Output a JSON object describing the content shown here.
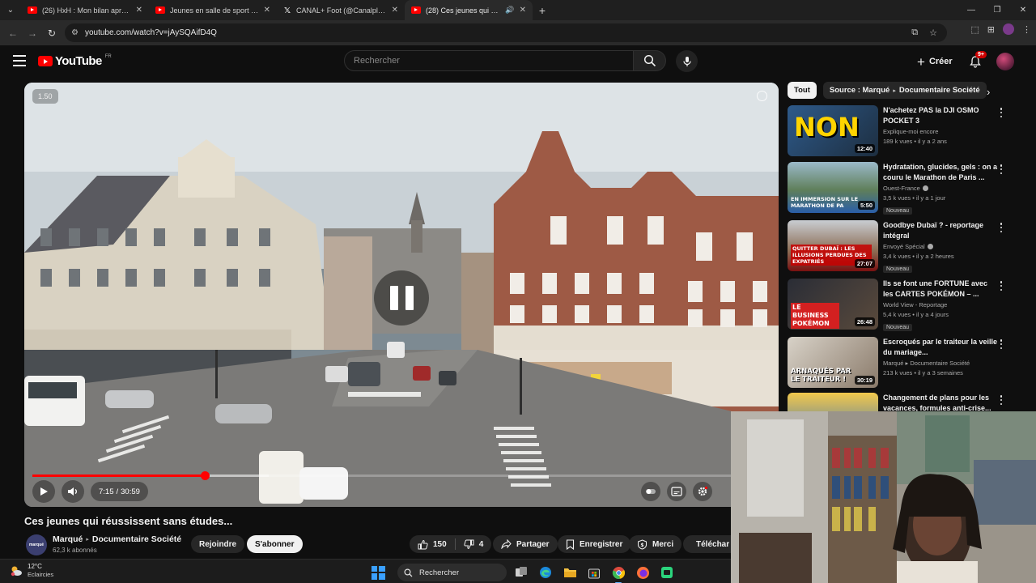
{
  "browser": {
    "tabs": [
      {
        "title": "(26) HxH : Mon bilan après 25 a",
        "icon": "youtube-icon",
        "active": false
      },
      {
        "title": "Jeunes en salle de sport : entre",
        "icon": "youtube-icon",
        "active": false
      },
      {
        "title": "CANAL+ Foot (@CanalplusFoot",
        "icon": "x-icon",
        "active": false
      },
      {
        "title": "(28) Ces jeunes qui réussiss",
        "icon": "youtube-icon",
        "active": true
      }
    ],
    "url": "youtube.com/watch?v=jAySQAifD4Q"
  },
  "youtube": {
    "logo_text": "YouTube",
    "logo_region": "FR",
    "search_placeholder": "Rechercher",
    "create_label": "Créer",
    "notif_badge": "9+"
  },
  "player": {
    "speed_badge": "1.50",
    "current_time": "7:15",
    "duration": "30:59",
    "progress_fraction": 0.234,
    "state": "paused-overlay"
  },
  "video": {
    "title": "Ces jeunes qui réussissent sans études...",
    "channel_name": "Marqué",
    "channel_sub": "Documentaire Société",
    "channel_avatar_text": "marqué",
    "subscribers": "62,3 k abonnés",
    "join_label": "Rejoindre",
    "subscribe_label": "S'abonner",
    "likes": "150",
    "dislikes": "4",
    "share_label": "Partager",
    "save_label": "Enregistrer",
    "thanks_label": "Merci",
    "download_label": "Téléchar"
  },
  "sidebar": {
    "chips": [
      {
        "label": "Tout",
        "active": true
      },
      {
        "label": "Source : Marqué",
        "label2": "Documentaire Société",
        "active": false
      }
    ],
    "recommendations": [
      {
        "title": "N'achetez PAS la DJI OSMO POCKET 3",
        "channel": "Explique-moi encore",
        "verified": false,
        "views": "189 k vues",
        "age": "il y a 2 ans",
        "duration": "12:40",
        "is_new": false,
        "thumb_text": "NON"
      },
      {
        "title": "Hydratation, glucides, gels : on a couru le Marathon de Paris ...",
        "channel": "Ouest-France",
        "verified": true,
        "views": "3,5 k vues",
        "age": "il y a 1 jour",
        "duration": "5:50",
        "is_new": true,
        "new_label": "Nouveau",
        "thumb_text": "EN IMMERSION SUR LE MARATHON DE PA"
      },
      {
        "title": "Goodbye Dubaï ? - reportage intégral",
        "channel": "Envoyé Spécial",
        "verified": true,
        "views": "3,4 k vues",
        "age": "il y a 2 heures",
        "duration": "27:07",
        "is_new": true,
        "new_label": "Nouveau",
        "thumb_text": "QUITTER DUBAÏ : LES ILLUSIONS PERDUES DES EXPATRIÉS"
      },
      {
        "title": "Ils se font une FORTUNE avec les CARTES POKÉMON – ...",
        "channel": "World View - Reportage",
        "verified": false,
        "views": "5,4 k vues",
        "age": "il y a 4 jours",
        "duration": "26:48",
        "is_new": true,
        "new_label": "Nouveau",
        "thumb_text": "LE BUSINESS POKÉMON"
      },
      {
        "title": "Escroqués par le traiteur la veille du mariage...",
        "channel": "Marqué ▸ Documentaire Société",
        "verified": false,
        "views": "213 k vues",
        "age": "il y a 3 semaines",
        "duration": "30:19",
        "is_new": false,
        "thumb_text": "ARNAQUÉS PAR LE TRAITEUR !"
      },
      {
        "title": "Changement de plans pour les vacances, formules anti-crise...",
        "channel": "",
        "verified": false,
        "views": "",
        "age": "",
        "duration": "",
        "is_new": false,
        "thumb_text": ""
      }
    ]
  },
  "taskbar": {
    "temperature": "12°C",
    "weather_text": "Eclaircies",
    "search_label": "Rechercher"
  }
}
